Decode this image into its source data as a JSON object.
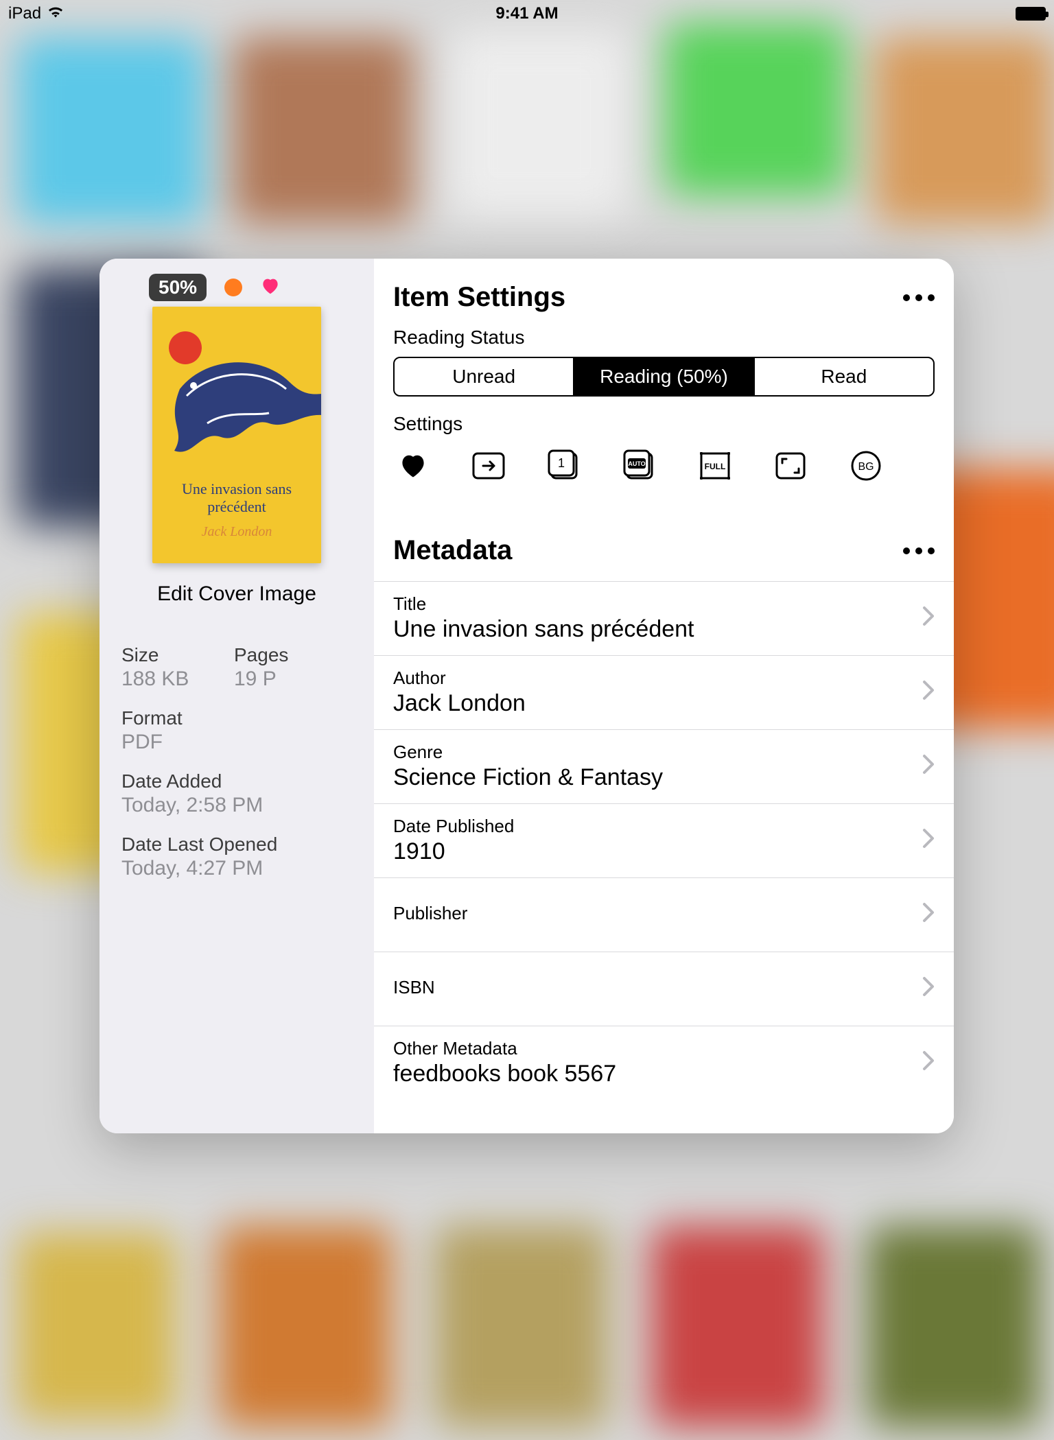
{
  "statusbar": {
    "device": "iPad",
    "time": "9:41 AM"
  },
  "cover": {
    "progress_badge": "50%",
    "title": "Une invasion sans précédent",
    "author": "Jack London",
    "edit_label": "Edit Cover Image"
  },
  "file_info": {
    "size_label": "Size",
    "size_value": "188 KB",
    "pages_label": "Pages",
    "pages_value": "19 P",
    "format_label": "Format",
    "format_value": "PDF",
    "added_label": "Date Added",
    "added_value": "Today, 2:58 PM",
    "opened_label": "Date Last Opened",
    "opened_value": "Today, 4:27 PM"
  },
  "settings": {
    "header": "Item Settings",
    "reading_status_label": "Reading Status",
    "segments": {
      "unread": "Unread",
      "reading": "Reading (50%)",
      "read": "Read"
    },
    "active_segment": "reading",
    "settings_label": "Settings"
  },
  "metadata": {
    "header": "Metadata",
    "rows": [
      {
        "label": "Title",
        "value": "Une invasion sans précédent"
      },
      {
        "label": "Author",
        "value": "Jack London"
      },
      {
        "label": "Genre",
        "value": "Science Fiction & Fantasy"
      },
      {
        "label": "Date Published",
        "value": "1910"
      },
      {
        "label": "Publisher",
        "value": ""
      },
      {
        "label": "ISBN",
        "value": ""
      },
      {
        "label": "Other Metadata",
        "value": "feedbooks book 5567"
      }
    ]
  }
}
